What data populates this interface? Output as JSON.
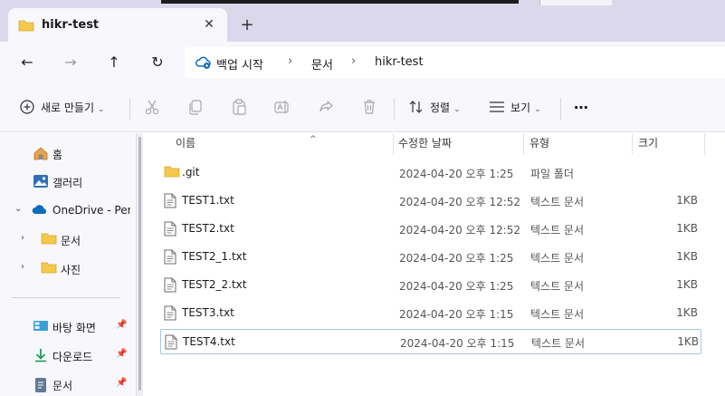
{
  "window": {
    "tab_title": "hikr-test",
    "tab_close": "✕",
    "new_tab": "+"
  },
  "nav": {
    "back": "←",
    "forward": "→",
    "up": "↑",
    "refresh": "↻"
  },
  "breadcrumb": {
    "items": [
      "백업 시작",
      "문서",
      "hikr-test"
    ],
    "separator": "›"
  },
  "toolbar": {
    "new_label": "새로 만들기",
    "sort_label": "정렬",
    "view_label": "보기",
    "more_label": "⋯",
    "chevron": "⌄"
  },
  "sidebar": {
    "items": [
      {
        "label": "홈",
        "icon": "home-icon"
      },
      {
        "label": "갤러리",
        "icon": "gallery-icon"
      },
      {
        "label": "OneDrive - Pers",
        "icon": "cloud-icon",
        "expander": "⌄"
      },
      {
        "label": "문서",
        "icon": "folder-icon",
        "expander": "›"
      },
      {
        "label": "사진",
        "icon": "folder-icon",
        "expander": "›"
      },
      {
        "label": "바탕 화면",
        "icon": "desktop-icon",
        "pin": "📌"
      },
      {
        "label": "다운로드",
        "icon": "download-icon",
        "pin": "📌"
      },
      {
        "label": "문서",
        "icon": "document-icon",
        "pin": "📌"
      }
    ]
  },
  "columns": {
    "name": "이름",
    "modified": "수정한 날짜",
    "type": "유형",
    "size": "크기",
    "sort_caret": "^"
  },
  "files": [
    {
      "name": ".git",
      "modified": "2024-04-20 오후 1:25",
      "type": "파일 폴더",
      "size": "",
      "kind": "folder"
    },
    {
      "name": "TEST1.txt",
      "modified": "2024-04-20 오후 12:52",
      "type": "텍스트 문서",
      "size": "1KB",
      "kind": "text"
    },
    {
      "name": "TEST2.txt",
      "modified": "2024-04-20 오후 12:52",
      "type": "텍스트 문서",
      "size": "1KB",
      "kind": "text"
    },
    {
      "name": "TEST2_1.txt",
      "modified": "2024-04-20 오후 1:25",
      "type": "텍스트 문서",
      "size": "1KB",
      "kind": "text"
    },
    {
      "name": "TEST2_2.txt",
      "modified": "2024-04-20 오후 1:25",
      "type": "텍스트 문서",
      "size": "1KB",
      "kind": "text"
    },
    {
      "name": "TEST3.txt",
      "modified": "2024-04-20 오후 1:15",
      "type": "텍스트 문서",
      "size": "1KB",
      "kind": "text"
    },
    {
      "name": "TEST4.txt",
      "modified": "2024-04-20 오후 1:15",
      "type": "텍스트 문서",
      "size": "1KB",
      "kind": "text",
      "selected": true
    }
  ],
  "colors": {
    "titlebar": "#dcd8ec",
    "chrome": "#f8f7fc",
    "folder": "#f2c94c",
    "accent": "#0f6cbd",
    "selection_border": "#a6c6e8"
  }
}
